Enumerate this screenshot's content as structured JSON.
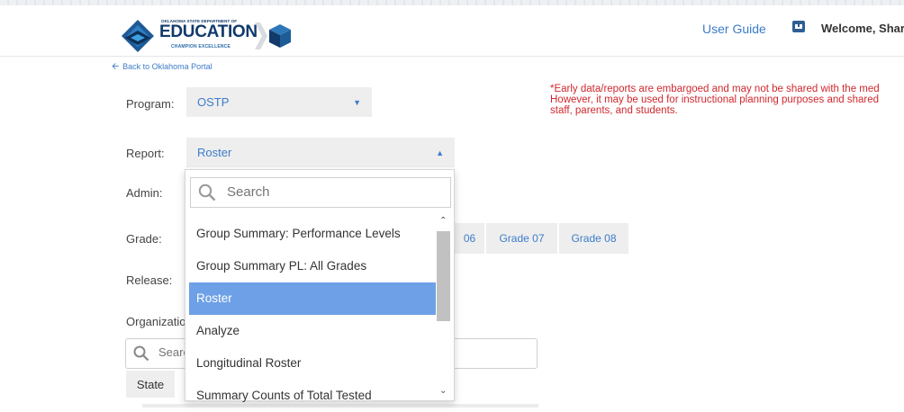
{
  "header": {
    "logo": {
      "small": "OKLAHOMA STATE DEPARTMENT OF",
      "main": "EDUCATION",
      "tagline": "CHAMPION EXCELLENCE"
    },
    "user_guide": "User Guide",
    "welcome": "Welcome, Sharr"
  },
  "back_link": "Back to Oklahoma Portal",
  "notice": {
    "line1": "*Early data/reports are embargoed and may not be shared with the med",
    "line2": "However, it may be used for instructional planning purposes and shared",
    "line3": "staff, parents, and students."
  },
  "labels": {
    "program": "Program:",
    "report": "Report:",
    "admin": "Admin:",
    "grade": "Grade:",
    "release": "Release:",
    "organization": "Organizatio"
  },
  "program_select": {
    "value": "OSTP"
  },
  "report_select": {
    "value": "Roster"
  },
  "dropdown": {
    "search_placeholder": "Search",
    "items": [
      "Group Summary: Performance Levels",
      "Group Summary PL: All Grades",
      "Roster",
      "Analyze",
      "Longitudinal Roster",
      "Summary Counts of Total Tested"
    ],
    "selected": "Roster"
  },
  "grades": [
    "06",
    "Grade 07",
    "Grade 08"
  ],
  "org_search": {
    "placeholder": "Searc"
  },
  "state_button": "State",
  "colors": {
    "accent": "#3d7cc9",
    "selected_bg": "#6da0e6",
    "notice": "#d0282e",
    "control_bg": "#eeeeee"
  }
}
